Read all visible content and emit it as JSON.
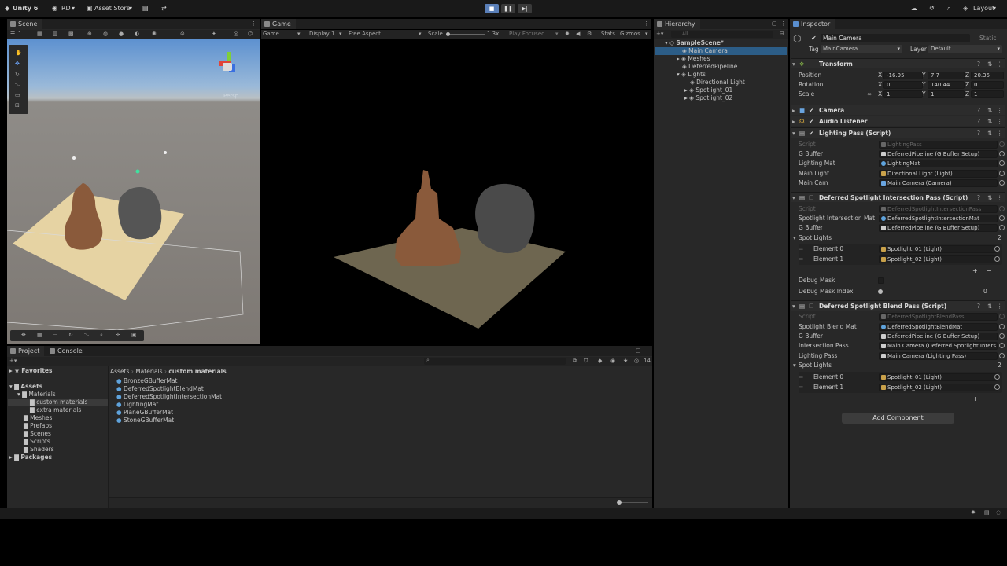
{
  "topbar": {
    "app": "Unity 6",
    "account": "RD",
    "store": "Asset Store",
    "layout": "Layout"
  },
  "scene": {
    "tab": "Scene",
    "layer_count": "1",
    "view_label": "Persp"
  },
  "game": {
    "tab": "Game",
    "mode": "Game",
    "display": "Display 1",
    "aspect": "Free Aspect",
    "scale_label": "Scale",
    "scale_value": "1.3x",
    "play_focused": "Play Focused",
    "stats": "Stats",
    "gizmos": "Gizmos"
  },
  "hierarchy": {
    "tab": "Hierarchy",
    "search_placeholder": "All",
    "items": [
      {
        "label": "SampleScene*",
        "indent": 0
      },
      {
        "label": "Main Camera",
        "indent": 1
      },
      {
        "label": "Meshes",
        "indent": 1
      },
      {
        "label": "DeferredPipeline",
        "indent": 1
      },
      {
        "label": "Lights",
        "indent": 1
      },
      {
        "label": "Directional Light",
        "indent": 2
      },
      {
        "label": "Spotlight_01",
        "indent": 2
      },
      {
        "label": "Spotlight_02",
        "indent": 2
      }
    ]
  },
  "inspector": {
    "tab": "Inspector",
    "object_name": "Main Camera",
    "static_label": "Static",
    "tag_label": "Tag",
    "tag_value": "MainCamera",
    "layer_label": "Layer",
    "layer_value": "Default",
    "transform": {
      "title": "Transform",
      "position_label": "Position",
      "rotation_label": "Rotation",
      "scale_label": "Scale",
      "position": [
        "-16.95",
        "7.7",
        "20.35"
      ],
      "rotation": [
        "0",
        "140.44",
        "0"
      ],
      "scale": [
        "1",
        "1",
        "1"
      ],
      "x": "X",
      "y": "Y",
      "z": "Z"
    },
    "camera": "Camera",
    "audio_listener": "Audio Listener",
    "lighting_pass": {
      "title": "Lighting Pass (Script)",
      "script_label": "Script",
      "script_value": "LightingPass",
      "gbuffer_label": "G Buffer",
      "gbuffer_value": "DeferredPipeline (G Buffer Setup)",
      "mat_label": "Lighting Mat",
      "mat_value": "LightingMat",
      "light_label": "Main Light",
      "light_value": "Directional Light (Light)",
      "cam_label": "Main Cam",
      "cam_value": "Main Camera (Camera)"
    },
    "intersection_pass": {
      "title": "Deferred Spotlight Intersection Pass (Script)",
      "script_label": "Script",
      "script_value": "DeferredSpotlightIntersectionPass",
      "mat_label": "Spotlight Intersection Mat",
      "mat_value": "DeferredSpotlightIntersectionMat",
      "gbuffer_label": "G Buffer",
      "gbuffer_value": "DeferredPipeline (G Buffer Setup)",
      "spot_label": "Spot Lights",
      "spot_count": "2",
      "el0_label": "Element 0",
      "el0_value": "Spotlight_01 (Light)",
      "el1_label": "Element 1",
      "el1_value": "Spotlight_02 (Light)",
      "debug_mask_label": "Debug Mask",
      "debug_index_label": "Debug Mask Index",
      "debug_index_value": "0"
    },
    "blend_pass": {
      "title": "Deferred Spotlight Blend Pass (Script)",
      "script_label": "Script",
      "script_value": "DeferredSpotlightBlendPass",
      "mat_label": "Spotlight Blend Mat",
      "mat_value": "DeferredSpotlightBlendMat",
      "gbuffer_label": "G Buffer",
      "gbuffer_value": "DeferredPipeline (G Buffer Setup)",
      "inter_label": "Intersection Pass",
      "inter_value": "Main Camera (Deferred Spotlight Inters",
      "lp_label": "Lighting Pass",
      "lp_value": "Main Camera (Lighting Pass)",
      "spot_label": "Spot Lights",
      "spot_count": "2",
      "el0_label": "Element 0",
      "el0_value": "Spotlight_01 (Light)",
      "el1_label": "Element 1",
      "el1_value": "Spotlight_02 (Light)"
    },
    "add_component": "Add Component"
  },
  "project": {
    "tab_project": "Project",
    "tab_console": "Console",
    "console_count": "14",
    "favorites": "Favorites",
    "assets": "Assets",
    "tree": [
      {
        "label": "Materials",
        "indent": 1
      },
      {
        "label": "custom materials",
        "indent": 2,
        "selected": true
      },
      {
        "label": "extra materials",
        "indent": 2
      },
      {
        "label": "Meshes",
        "indent": 1
      },
      {
        "label": "Prefabs",
        "indent": 1
      },
      {
        "label": "Scenes",
        "indent": 1
      },
      {
        "label": "Scripts",
        "indent": 1
      },
      {
        "label": "Shaders",
        "indent": 1
      }
    ],
    "packages": "Packages",
    "breadcrumb": [
      "Assets",
      "Materials",
      "custom materials"
    ],
    "files": [
      "BronzeGBufferMat",
      "DeferredSpotlightBlendMat",
      "DeferredSpotlightIntersectionMat",
      "LightingMat",
      "PlaneGBufferMat",
      "StoneGBufferMat"
    ]
  },
  "colors": {
    "accent": "#3d5a80",
    "selection": "#2c5d87",
    "panel": "#282828",
    "bronze": "#8a5a3b",
    "stone": "#5a5a5a"
  }
}
